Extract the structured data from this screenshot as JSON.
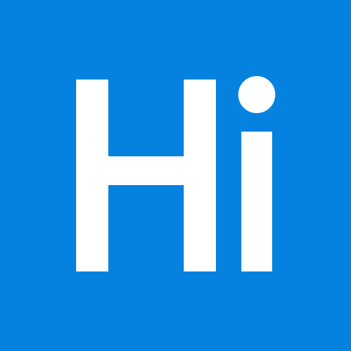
{
  "logo": {
    "text": "Hi",
    "background_color": "#0582E0",
    "foreground_color": "#FFFFFF"
  }
}
